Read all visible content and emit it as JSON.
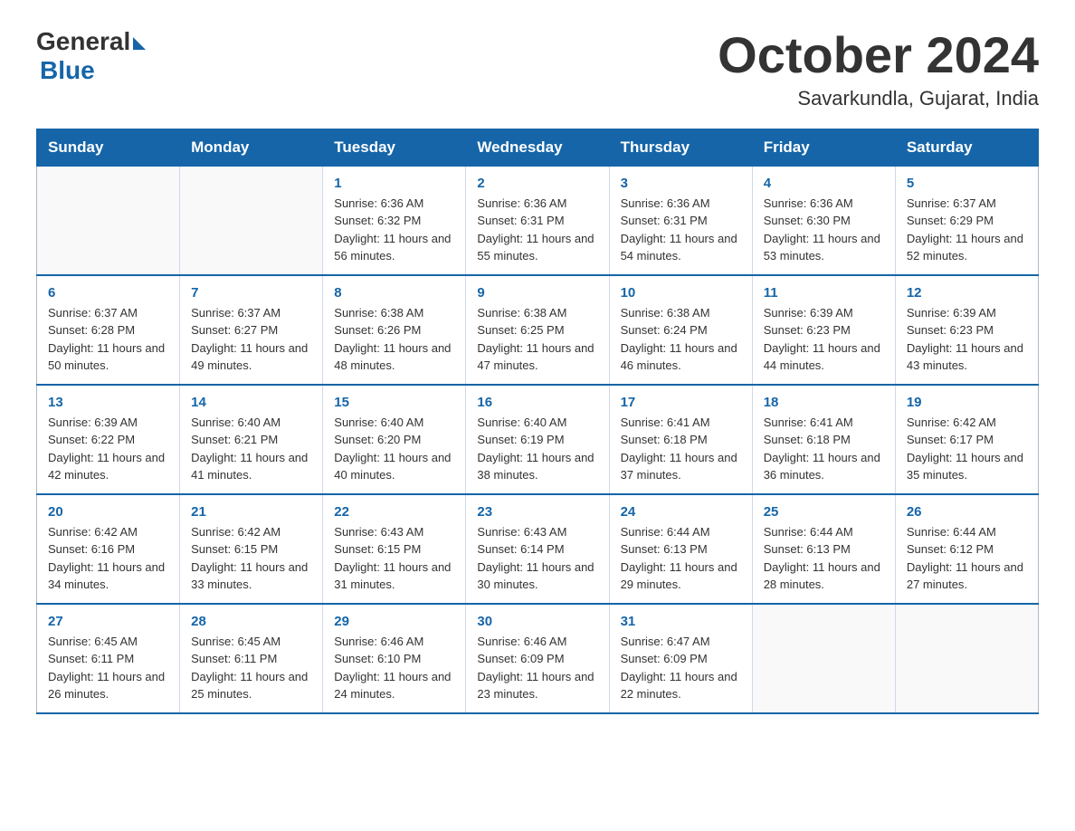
{
  "header": {
    "logo_general": "General",
    "logo_blue": "Blue",
    "month_title": "October 2024",
    "location": "Savarkundla, Gujarat, India"
  },
  "weekdays": [
    "Sunday",
    "Monday",
    "Tuesday",
    "Wednesday",
    "Thursday",
    "Friday",
    "Saturday"
  ],
  "weeks": [
    [
      {
        "day": "",
        "sunrise": "",
        "sunset": "",
        "daylight": ""
      },
      {
        "day": "",
        "sunrise": "",
        "sunset": "",
        "daylight": ""
      },
      {
        "day": "1",
        "sunrise": "Sunrise: 6:36 AM",
        "sunset": "Sunset: 6:32 PM",
        "daylight": "Daylight: 11 hours and 56 minutes."
      },
      {
        "day": "2",
        "sunrise": "Sunrise: 6:36 AM",
        "sunset": "Sunset: 6:31 PM",
        "daylight": "Daylight: 11 hours and 55 minutes."
      },
      {
        "day": "3",
        "sunrise": "Sunrise: 6:36 AM",
        "sunset": "Sunset: 6:31 PM",
        "daylight": "Daylight: 11 hours and 54 minutes."
      },
      {
        "day": "4",
        "sunrise": "Sunrise: 6:36 AM",
        "sunset": "Sunset: 6:30 PM",
        "daylight": "Daylight: 11 hours and 53 minutes."
      },
      {
        "day": "5",
        "sunrise": "Sunrise: 6:37 AM",
        "sunset": "Sunset: 6:29 PM",
        "daylight": "Daylight: 11 hours and 52 minutes."
      }
    ],
    [
      {
        "day": "6",
        "sunrise": "Sunrise: 6:37 AM",
        "sunset": "Sunset: 6:28 PM",
        "daylight": "Daylight: 11 hours and 50 minutes."
      },
      {
        "day": "7",
        "sunrise": "Sunrise: 6:37 AM",
        "sunset": "Sunset: 6:27 PM",
        "daylight": "Daylight: 11 hours and 49 minutes."
      },
      {
        "day": "8",
        "sunrise": "Sunrise: 6:38 AM",
        "sunset": "Sunset: 6:26 PM",
        "daylight": "Daylight: 11 hours and 48 minutes."
      },
      {
        "day": "9",
        "sunrise": "Sunrise: 6:38 AM",
        "sunset": "Sunset: 6:25 PM",
        "daylight": "Daylight: 11 hours and 47 minutes."
      },
      {
        "day": "10",
        "sunrise": "Sunrise: 6:38 AM",
        "sunset": "Sunset: 6:24 PM",
        "daylight": "Daylight: 11 hours and 46 minutes."
      },
      {
        "day": "11",
        "sunrise": "Sunrise: 6:39 AM",
        "sunset": "Sunset: 6:23 PM",
        "daylight": "Daylight: 11 hours and 44 minutes."
      },
      {
        "day": "12",
        "sunrise": "Sunrise: 6:39 AM",
        "sunset": "Sunset: 6:23 PM",
        "daylight": "Daylight: 11 hours and 43 minutes."
      }
    ],
    [
      {
        "day": "13",
        "sunrise": "Sunrise: 6:39 AM",
        "sunset": "Sunset: 6:22 PM",
        "daylight": "Daylight: 11 hours and 42 minutes."
      },
      {
        "day": "14",
        "sunrise": "Sunrise: 6:40 AM",
        "sunset": "Sunset: 6:21 PM",
        "daylight": "Daylight: 11 hours and 41 minutes."
      },
      {
        "day": "15",
        "sunrise": "Sunrise: 6:40 AM",
        "sunset": "Sunset: 6:20 PM",
        "daylight": "Daylight: 11 hours and 40 minutes."
      },
      {
        "day": "16",
        "sunrise": "Sunrise: 6:40 AM",
        "sunset": "Sunset: 6:19 PM",
        "daylight": "Daylight: 11 hours and 38 minutes."
      },
      {
        "day": "17",
        "sunrise": "Sunrise: 6:41 AM",
        "sunset": "Sunset: 6:18 PM",
        "daylight": "Daylight: 11 hours and 37 minutes."
      },
      {
        "day": "18",
        "sunrise": "Sunrise: 6:41 AM",
        "sunset": "Sunset: 6:18 PM",
        "daylight": "Daylight: 11 hours and 36 minutes."
      },
      {
        "day": "19",
        "sunrise": "Sunrise: 6:42 AM",
        "sunset": "Sunset: 6:17 PM",
        "daylight": "Daylight: 11 hours and 35 minutes."
      }
    ],
    [
      {
        "day": "20",
        "sunrise": "Sunrise: 6:42 AM",
        "sunset": "Sunset: 6:16 PM",
        "daylight": "Daylight: 11 hours and 34 minutes."
      },
      {
        "day": "21",
        "sunrise": "Sunrise: 6:42 AM",
        "sunset": "Sunset: 6:15 PM",
        "daylight": "Daylight: 11 hours and 33 minutes."
      },
      {
        "day": "22",
        "sunrise": "Sunrise: 6:43 AM",
        "sunset": "Sunset: 6:15 PM",
        "daylight": "Daylight: 11 hours and 31 minutes."
      },
      {
        "day": "23",
        "sunrise": "Sunrise: 6:43 AM",
        "sunset": "Sunset: 6:14 PM",
        "daylight": "Daylight: 11 hours and 30 minutes."
      },
      {
        "day": "24",
        "sunrise": "Sunrise: 6:44 AM",
        "sunset": "Sunset: 6:13 PM",
        "daylight": "Daylight: 11 hours and 29 minutes."
      },
      {
        "day": "25",
        "sunrise": "Sunrise: 6:44 AM",
        "sunset": "Sunset: 6:13 PM",
        "daylight": "Daylight: 11 hours and 28 minutes."
      },
      {
        "day": "26",
        "sunrise": "Sunrise: 6:44 AM",
        "sunset": "Sunset: 6:12 PM",
        "daylight": "Daylight: 11 hours and 27 minutes."
      }
    ],
    [
      {
        "day": "27",
        "sunrise": "Sunrise: 6:45 AM",
        "sunset": "Sunset: 6:11 PM",
        "daylight": "Daylight: 11 hours and 26 minutes."
      },
      {
        "day": "28",
        "sunrise": "Sunrise: 6:45 AM",
        "sunset": "Sunset: 6:11 PM",
        "daylight": "Daylight: 11 hours and 25 minutes."
      },
      {
        "day": "29",
        "sunrise": "Sunrise: 6:46 AM",
        "sunset": "Sunset: 6:10 PM",
        "daylight": "Daylight: 11 hours and 24 minutes."
      },
      {
        "day": "30",
        "sunrise": "Sunrise: 6:46 AM",
        "sunset": "Sunset: 6:09 PM",
        "daylight": "Daylight: 11 hours and 23 minutes."
      },
      {
        "day": "31",
        "sunrise": "Sunrise: 6:47 AM",
        "sunset": "Sunset: 6:09 PM",
        "daylight": "Daylight: 11 hours and 22 minutes."
      },
      {
        "day": "",
        "sunrise": "",
        "sunset": "",
        "daylight": ""
      },
      {
        "day": "",
        "sunrise": "",
        "sunset": "",
        "daylight": ""
      }
    ]
  ]
}
